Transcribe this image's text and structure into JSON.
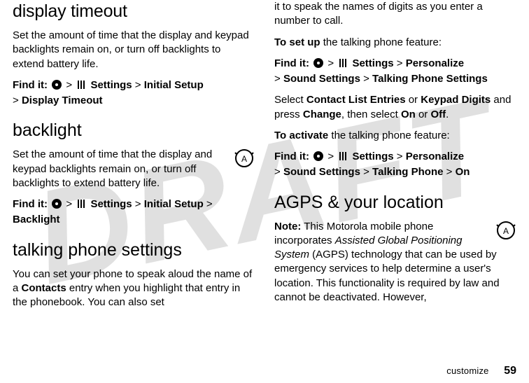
{
  "watermark": "DRAFT",
  "left": {
    "h_display_timeout": "display timeout",
    "p_display_timeout": "Set the amount of time that the display and keypad backlights remain on, or turn off backlights to extend battery life.",
    "find1_pre": "Find it:",
    "find1_settings": "Settings",
    "find1_path1": "Initial Setup",
    "find1_path2": "Display Timeout",
    "h_backlight": "backlight",
    "p_backlight": "Set the amount of time that the display and keypad backlights remain on, or turn off backlights to extend battery life.",
    "find2_pre": "Find it:",
    "find2_settings": "Settings",
    "find2_path1": "Initial Setup",
    "find2_path2": "Backlight",
    "h_talking": "talking phone settings",
    "p_talking_a": "You can set your phone to speak aloud the name of a ",
    "p_talking_contacts": "Contacts",
    "p_talking_b": " entry when you highlight that entry in the phonebook. You can also set"
  },
  "right": {
    "p_cont": "it to speak the names of digits as you enter a number to call.",
    "to_set_up_bold": "To set up",
    "to_set_up_rest": " the talking phone feature:",
    "find3_pre": "Find it:",
    "find3_settings": "Settings",
    "find3_path1": "Personalize",
    "find3_path2": "Sound Settings",
    "find3_path3": "Talking Phone Settings",
    "select_a": "Select ",
    "cle": "Contact List Entries",
    "select_or": " or ",
    "kd": "Keypad Digits",
    "select_b": " and press ",
    "change": "Change",
    "select_c": ", then select ",
    "on": "On",
    "or2": " or ",
    "off": "Off",
    "dot": ".",
    "to_activate_bold": "To activate",
    "to_activate_rest": " the talking phone feature:",
    "find4_pre": "Find it:",
    "find4_settings": "Settings",
    "find4_path1": "Personalize",
    "find4_path2": "Sound Settings",
    "find4_path3": "Talking Phone",
    "find4_path4": "On",
    "h_agps": "AGPS & your location",
    "note_bold": "Note:",
    "note_a": " This Motorola mobile phone incorporates ",
    "agps_it": "Assisted Global Positioning System",
    "note_b": " (AGPS) technology that can be used by emergency services to help determine a user's location. This functionality is required by law and cannot be deactivated. However,"
  },
  "footer": {
    "label": "customize",
    "page": "59"
  },
  "gt": ">"
}
